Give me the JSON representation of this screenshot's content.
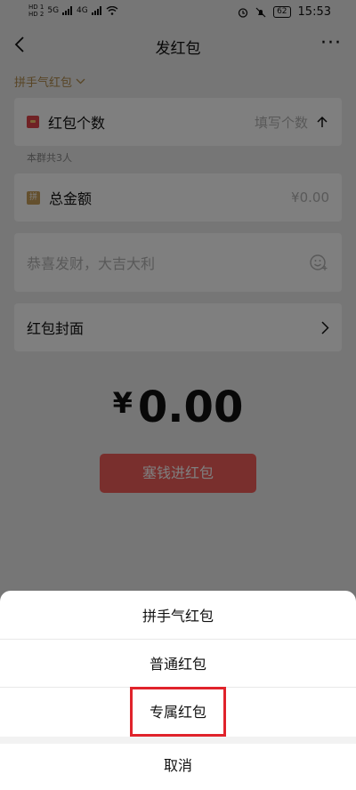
{
  "status_bar": {
    "hd1": "HD 1",
    "hd2": "HD 2",
    "net1": "5G",
    "net2": "4G",
    "battery": "62",
    "time": "15:53"
  },
  "nav": {
    "title": "发红包",
    "more": "···"
  },
  "type_selector": {
    "label": "拼手气红包"
  },
  "count_row": {
    "label": "红包个数",
    "placeholder": "填写个数"
  },
  "group_hint": "本群共3人",
  "total_row": {
    "icon_text": "拼",
    "label": "总金额",
    "value": "¥0.00"
  },
  "greeting": {
    "placeholder": "恭喜发财，大吉大利"
  },
  "cover_row": {
    "label": "红包封面"
  },
  "amount": {
    "currency": "¥",
    "value": "0.00"
  },
  "submit_button": "塞钱进红包",
  "action_sheet": {
    "options": [
      "拼手气红包",
      "普通红包",
      "专属红包"
    ],
    "cancel": "取消"
  },
  "highlight_color": "#e0232b"
}
